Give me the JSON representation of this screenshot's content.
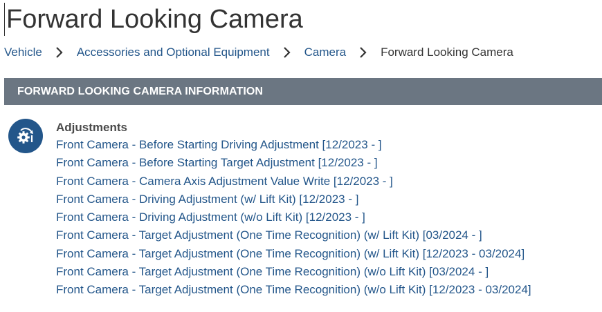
{
  "page": {
    "title": "Forward Looking Camera"
  },
  "breadcrumb": {
    "items": [
      {
        "label": "Vehicle"
      },
      {
        "label": "Accessories and Optional Equipment"
      },
      {
        "label": "Camera"
      },
      {
        "label": "Forward Looking Camera"
      }
    ],
    "separator_icon": "chevron-right-icon"
  },
  "section": {
    "header": "FORWARD LOOKING CAMERA INFORMATION",
    "icon": "adjustment-gear-icon",
    "heading": "Adjustments",
    "links": [
      {
        "label": "Front Camera - Before Starting Driving Adjustment [12/2023 - ]"
      },
      {
        "label": "Front Camera - Before Starting Target Adjustment [12/2023 - ]"
      },
      {
        "label": "Front Camera - Camera Axis Adjustment Value Write [12/2023 - ]"
      },
      {
        "label": "Front Camera - Driving Adjustment (w/ Lift Kit) [12/2023 - ]"
      },
      {
        "label": "Front Camera - Driving Adjustment (w/o Lift Kit) [12/2023 - ]"
      },
      {
        "label": "Front Camera - Target Adjustment (One Time Recognition) (w/ Lift Kit) [03/2024 - ]"
      },
      {
        "label": "Front Camera - Target Adjustment (One Time Recognition) (w/ Lift Kit) [12/2023 - 03/2024]"
      },
      {
        "label": "Front Camera - Target Adjustment (One Time Recognition) (w/o Lift Kit) [03/2024 - ]"
      },
      {
        "label": "Front Camera - Target Adjustment (One Time Recognition) (w/o Lift Kit) [12/2023 - 03/2024]"
      }
    ]
  },
  "colors": {
    "link": "#23568a",
    "header_bg": "#6b7682",
    "header_text": "#ffffff",
    "icon_bg": "#23568a",
    "text": "#333333"
  }
}
